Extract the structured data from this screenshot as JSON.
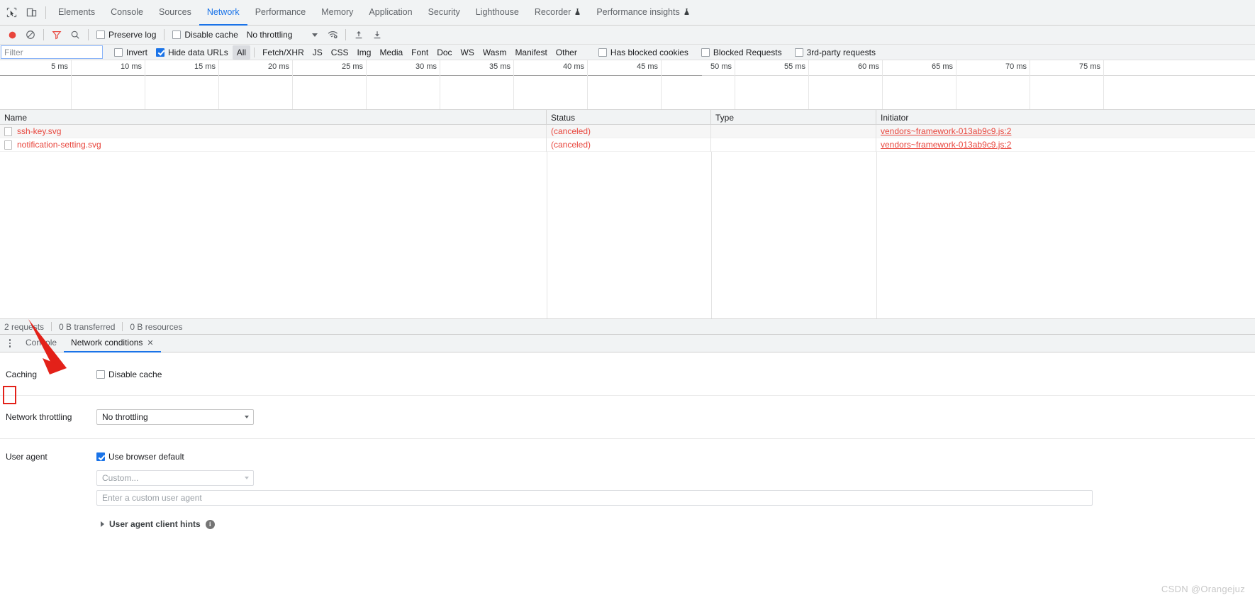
{
  "window": {
    "watermark": "CSDN @Orangejuz"
  },
  "main_tabs": {
    "inspect_icon": "inspect-cursor-icon",
    "device_icon": "device-toolbar-icon",
    "items": [
      {
        "label": "Elements",
        "active": false,
        "experimental": false
      },
      {
        "label": "Console",
        "active": false,
        "experimental": false
      },
      {
        "label": "Sources",
        "active": false,
        "experimental": false
      },
      {
        "label": "Network",
        "active": true,
        "experimental": false
      },
      {
        "label": "Performance",
        "active": false,
        "experimental": false
      },
      {
        "label": "Memory",
        "active": false,
        "experimental": false
      },
      {
        "label": "Application",
        "active": false,
        "experimental": false
      },
      {
        "label": "Security",
        "active": false,
        "experimental": false
      },
      {
        "label": "Lighthouse",
        "active": false,
        "experimental": false
      },
      {
        "label": "Recorder",
        "active": false,
        "experimental": true
      },
      {
        "label": "Performance insights",
        "active": false,
        "experimental": true
      }
    ]
  },
  "network_toolbar": {
    "record_icon": "record-stop-icon",
    "clear_icon": "clear-icon",
    "filter_icon": "filter-funnel-icon",
    "search_icon": "search-icon",
    "preserve_log": {
      "label": "Preserve log",
      "checked": false
    },
    "disable_cache": {
      "label": "Disable cache",
      "checked": false
    },
    "throttling_value": "No throttling",
    "wifi_icon": "network-conditions-wifi-icon",
    "import_icon": "import-har-icon",
    "export_icon": "export-har-icon"
  },
  "filter_bar": {
    "filter_placeholder": "Filter",
    "filter_value": "",
    "invert": {
      "label": "Invert",
      "checked": false
    },
    "hide_data_urls": {
      "label": "Hide data URLs",
      "checked": true
    },
    "types": [
      "All",
      "Fetch/XHR",
      "JS",
      "CSS",
      "Img",
      "Media",
      "Font",
      "Doc",
      "WS",
      "Wasm",
      "Manifest",
      "Other"
    ],
    "selected_type": "All",
    "has_blocked_cookies": {
      "label": "Has blocked cookies",
      "checked": false
    },
    "blocked_requests": {
      "label": "Blocked Requests",
      "checked": false
    },
    "third_party_requests": {
      "label": "3rd-party requests",
      "checked": false
    }
  },
  "timeline": {
    "ticks": [
      "5 ms",
      "10 ms",
      "15 ms",
      "20 ms",
      "25 ms",
      "30 ms",
      "35 ms",
      "40 ms",
      "45 ms",
      "50 ms",
      "55 ms",
      "60 ms",
      "65 ms",
      "70 ms",
      "75 ms"
    ],
    "unit": "ms",
    "interval": 5,
    "max": 75
  },
  "requests_table": {
    "columns": [
      "Name",
      "Status",
      "Type",
      "Initiator"
    ],
    "rows": [
      {
        "name": "ssh-key.svg",
        "status": "(canceled)",
        "type": "",
        "initiator": "vendors~framework-013ab9c9.js:2"
      },
      {
        "name": "notification-setting.svg",
        "status": "(canceled)",
        "type": "",
        "initiator": "vendors~framework-013ab9c9.js:2"
      }
    ]
  },
  "status_bar": {
    "requests": "2 requests",
    "transferred": "0 B transferred",
    "resources": "0 B resources"
  },
  "drawer": {
    "more_icon": "more-options-kebab-icon",
    "tabs": [
      {
        "label": "Console",
        "active": false,
        "closable": false
      },
      {
        "label": "Network conditions",
        "active": true,
        "closable": true,
        "close_glyph": "✕"
      }
    ]
  },
  "network_conditions": {
    "caching": {
      "label": "Caching",
      "disable_cache": {
        "label": "Disable cache",
        "checked": false
      }
    },
    "throttling": {
      "label": "Network throttling",
      "value": "No throttling"
    },
    "user_agent": {
      "label": "User agent",
      "use_browser_default": {
        "label": "Use browser default",
        "checked": true
      },
      "custom_select_placeholder": "Custom...",
      "custom_input_placeholder": "Enter a custom user agent",
      "client_hints_label": "User agent client hints",
      "info_glyph": "i"
    }
  },
  "colors": {
    "accent": "#1a73e8",
    "error": "#e8453c",
    "annotation": "#e32119",
    "chrome_bg": "#f1f3f4"
  }
}
